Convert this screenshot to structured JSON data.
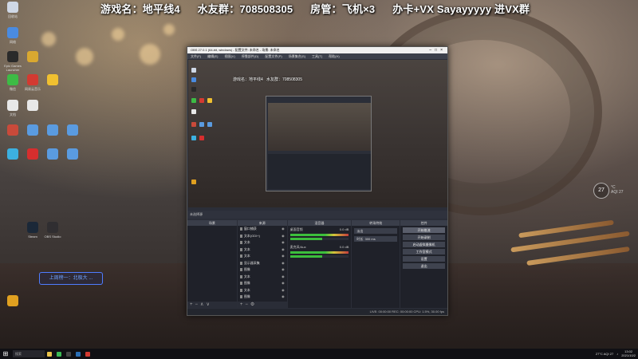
{
  "banner": {
    "game": "游戏名：地平线4",
    "fans": "水友群：708508305",
    "admin": "房管：飞机×3",
    "card": "办卡+VX Sayayyyyy 进VX群"
  },
  "desktop": {
    "icons": [
      {
        "label": "回收站",
        "color": "#cfd8e6"
      },
      {
        "label": "网络",
        "color": "#4a8be0"
      },
      {
        "label": "Epic Games Launcher",
        "color": "#2a2a2a"
      },
      {
        "label": "",
        "color": "#d9a830"
      },
      {
        "label": "微信",
        "color": "#3dbb45"
      },
      {
        "label": "网易云音乐",
        "color": "#d33a31"
      },
      {
        "label": "",
        "color": "#f0c030"
      },
      {
        "label": "文档",
        "color": "#e8e8e8"
      },
      {
        "label": "",
        "color": "#e8e8e8"
      },
      {
        "label": "",
        "color": "#c94a3a"
      },
      {
        "label": "",
        "color": "#5a9be0"
      },
      {
        "label": "",
        "color": "#5a9be0"
      },
      {
        "label": "",
        "color": "#5a9be0"
      },
      {
        "label": "",
        "color": "#3cb0e0"
      },
      {
        "label": "",
        "color": "#d62e2e"
      },
      {
        "label": "",
        "color": "#5a9be0"
      },
      {
        "label": "",
        "color": "#5a9be0"
      },
      {
        "label": "Steam",
        "color": "#1b2838"
      },
      {
        "label": "OBS Studio",
        "color": "#302e31"
      },
      {
        "label": "",
        "color": "#e0a020"
      }
    ],
    "side_label": "上周榜一：北极大 ..."
  },
  "obs": {
    "title": "OBS 27.0.1 (64-bit, windows) - 配置文件: 未命名 - 场景: 未命名",
    "menu": [
      "文件(F)",
      "编辑(E)",
      "视图(V)",
      "停靠部件(D)",
      "配置文件(P)",
      "场景集合(S)",
      "工具(T)",
      "帮助(H)"
    ],
    "toolbar_label": "未选择源",
    "docks": {
      "scenes": "场景",
      "sources": "来源",
      "mixer": "混音器",
      "transitions": "转场特效",
      "controls": "控件"
    },
    "sources": [
      "窗口捕获",
      "文本(GDI+)",
      "文本",
      "文本",
      "文本",
      "显示器采集",
      "图像",
      "文本",
      "图像",
      "文本",
      "图像",
      "音频"
    ],
    "mixer": [
      {
        "name": "桌面音频",
        "db": "0.0 dB"
      },
      {
        "name": "麦克风/Aux",
        "db": "0.0 dB"
      }
    ],
    "transition": {
      "type": "淡出",
      "duration_label": "时长",
      "duration": "300 ms"
    },
    "controls": [
      "开始推流",
      "开始录制",
      "启动虚拟摄像机",
      "工作室模式",
      "设置",
      "退出"
    ],
    "status": "LIVE: 00:00:00   REC: 00:00:00   CPU: 1.5%, 30.00 fps"
  },
  "weather": {
    "temp": "27",
    "unit": "°C",
    "extra": "AQI 27"
  },
  "taskbar": {
    "search": "搜索",
    "apps": [
      {
        "name": "explorer",
        "color": "#e8c24a"
      },
      {
        "name": "chrome",
        "color": "#3cba54"
      },
      {
        "name": "obs",
        "color": "#444"
      },
      {
        "name": "steam",
        "color": "#2a6eb5"
      },
      {
        "name": "forza",
        "color": "#d33a31"
      }
    ],
    "tray": {
      "weather": "27°C AQI 27",
      "time": "13:02",
      "date": "2021/10/2"
    }
  }
}
